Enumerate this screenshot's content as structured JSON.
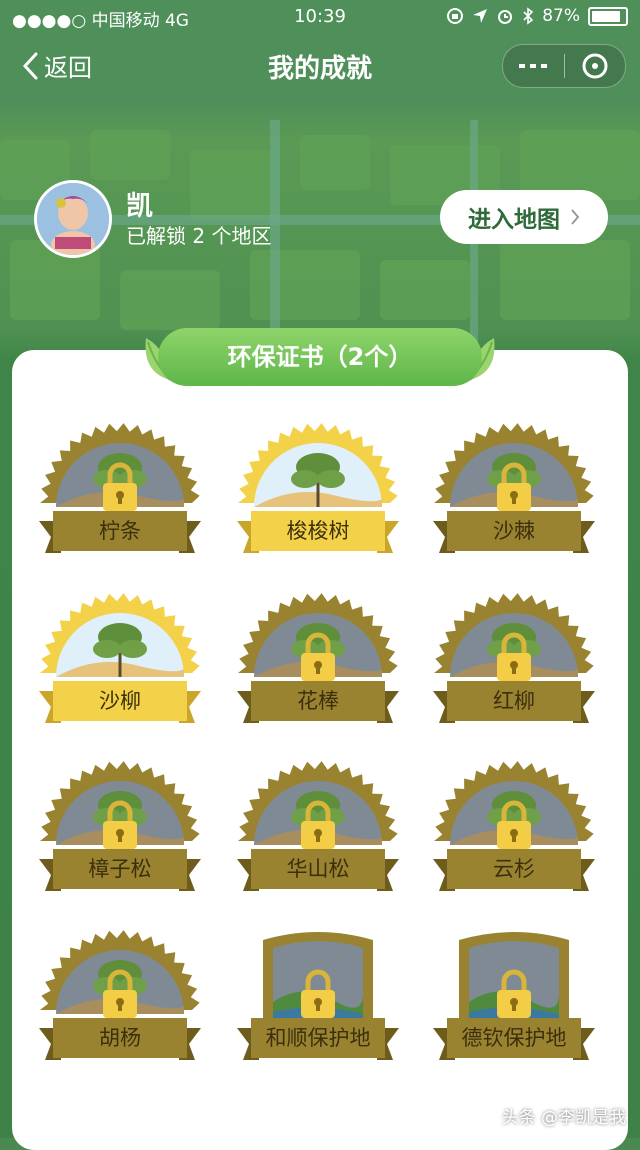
{
  "status_bar": {
    "carrier": "●●●●○ 中国移动  4G",
    "time": "10:39",
    "battery": "87%",
    "battery_level": 0.87
  },
  "nav": {
    "back_label": "返回",
    "title": "我的成就"
  },
  "profile": {
    "name": "凯",
    "unlocked_text": "已解锁 2 个地区",
    "map_button": "进入地图"
  },
  "section": {
    "title": "环保证书（2个）"
  },
  "badges": [
    {
      "label": "柠条",
      "unlocked": false,
      "shape": "round"
    },
    {
      "label": "梭梭树",
      "unlocked": true,
      "shape": "round"
    },
    {
      "label": "沙棘",
      "unlocked": false,
      "shape": "round"
    },
    {
      "label": "沙柳",
      "unlocked": true,
      "shape": "round"
    },
    {
      "label": "花棒",
      "unlocked": false,
      "shape": "round"
    },
    {
      "label": "红柳",
      "unlocked": false,
      "shape": "round"
    },
    {
      "label": "樟子松",
      "unlocked": false,
      "shape": "round"
    },
    {
      "label": "华山松",
      "unlocked": false,
      "shape": "round"
    },
    {
      "label": "云杉",
      "unlocked": false,
      "shape": "round"
    },
    {
      "label": "胡杨",
      "unlocked": false,
      "shape": "round"
    },
    {
      "label": "和顺保护地",
      "unlocked": false,
      "shape": "shield"
    },
    {
      "label": "德钦保护地",
      "unlocked": false,
      "shape": "shield"
    }
  ],
  "watermark": "头条 @李凯是我",
  "colors": {
    "locked_gold": "#9a8330",
    "unlocked_gold": "#f3d24a",
    "banner_green": "#6cc04f"
  }
}
